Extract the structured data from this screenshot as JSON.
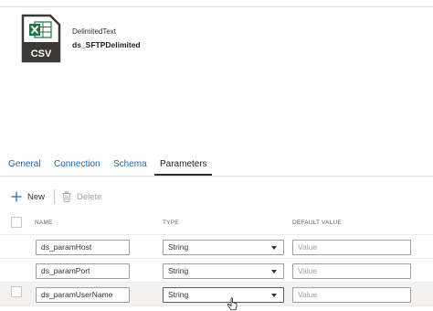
{
  "dataset": {
    "icon_label": "CSV",
    "type": "DelimitedText",
    "name": "ds_SFTPDelimited",
    "icon_color": "#217346"
  },
  "tabs": [
    {
      "label": "General",
      "active": false
    },
    {
      "label": "Connection",
      "active": false
    },
    {
      "label": "Schema",
      "active": false
    },
    {
      "label": "Parameters",
      "active": true
    }
  ],
  "toolbar": {
    "new_label": "New",
    "delete_label": "Delete"
  },
  "table": {
    "columns": [
      "NAME",
      "TYPE",
      "DEFAULT VALUE"
    ],
    "rows": [
      {
        "name": "ds_paramHost",
        "type": "String",
        "default_placeholder": "Value",
        "selected": false
      },
      {
        "name": "ds_paramPort",
        "type": "String",
        "default_placeholder": "Value",
        "selected": false
      },
      {
        "name": "ds_paramUserName",
        "type": "String",
        "default_placeholder": "Value",
        "selected": true
      }
    ]
  },
  "colors": {
    "accent": "#0f6cbd",
    "excel_green": "#217346"
  }
}
